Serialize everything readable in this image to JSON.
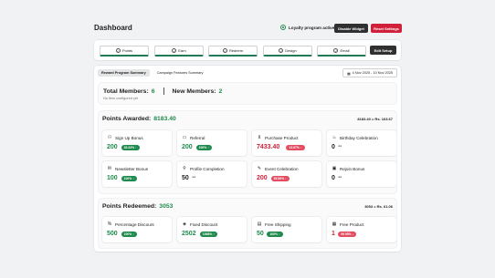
{
  "header": {
    "title": "Dashboard",
    "status_text": "Loyalty program active",
    "disable_button": "Disable Widget",
    "reset_button": "Reset Settings"
  },
  "tabs": {
    "items": [
      "Points",
      "Earn",
      "Redeem",
      "Design",
      "Email"
    ],
    "edit_setup": "Edit Setup"
  },
  "subtabs": {
    "reward": "Reward Program Summary",
    "campaign": "Campaign Features Summary"
  },
  "date_range": "4 Nov 2025 - 10 Nov 2025",
  "members": {
    "total_label": "Total Members:",
    "total_value": "6",
    "new_label": "New Members:",
    "new_value": "2",
    "note": "No tiers configured yet"
  },
  "awarded": {
    "title": "Points Awarded:",
    "value": "8183.40",
    "right": "8183.40 = Rs. 163.67",
    "items": [
      {
        "label": "Sign Up Bonus",
        "value": "200",
        "badge": "33.33% ↑",
        "icon": "user-plus-icon"
      },
      {
        "label": "Referral",
        "value": "200",
        "badge": "100% ↑",
        "icon": "folder-icon"
      },
      {
        "label": "Purchase Product",
        "value": "7433.40",
        "badge": "13.67% ↓",
        "icon": "cart-icon"
      },
      {
        "label": "Birthday Celebration",
        "value": "0",
        "badge": "--",
        "icon": "cake-icon"
      },
      {
        "label": "Newsletter Bonus",
        "value": "100",
        "badge": "100% ↑",
        "icon": "mail-icon"
      },
      {
        "label": "Profile Completion",
        "value": "50",
        "badge": "--",
        "icon": "user-icon"
      },
      {
        "label": "Event Celebration",
        "value": "200",
        "badge": "55.56% ↓",
        "icon": "chat-icon"
      },
      {
        "label": "Rejoin Bonus",
        "value": "0",
        "badge": "--",
        "icon": "archive-icon"
      }
    ]
  },
  "redeemed": {
    "title": "Points Redeemed:",
    "value": "3053",
    "right": "3053 = Rs. 61.06",
    "items": [
      {
        "label": "Percentage Discount",
        "value": "500",
        "badge": "100% ↑",
        "icon": "percent-icon"
      },
      {
        "label": "Fixed Discount",
        "value": "2502",
        "badge": "1568% ↑",
        "icon": "tag-icon"
      },
      {
        "label": "Free Shipping",
        "value": "50",
        "badge": "100% ↑",
        "icon": "truck-icon"
      },
      {
        "label": "Free Product",
        "value": "1",
        "badge": "99.95% ↓",
        "icon": "gift-icon"
      }
    ]
  },
  "colors": {
    "green": "#1f8a4d",
    "red": "#d0203a",
    "dark": "#303030"
  }
}
